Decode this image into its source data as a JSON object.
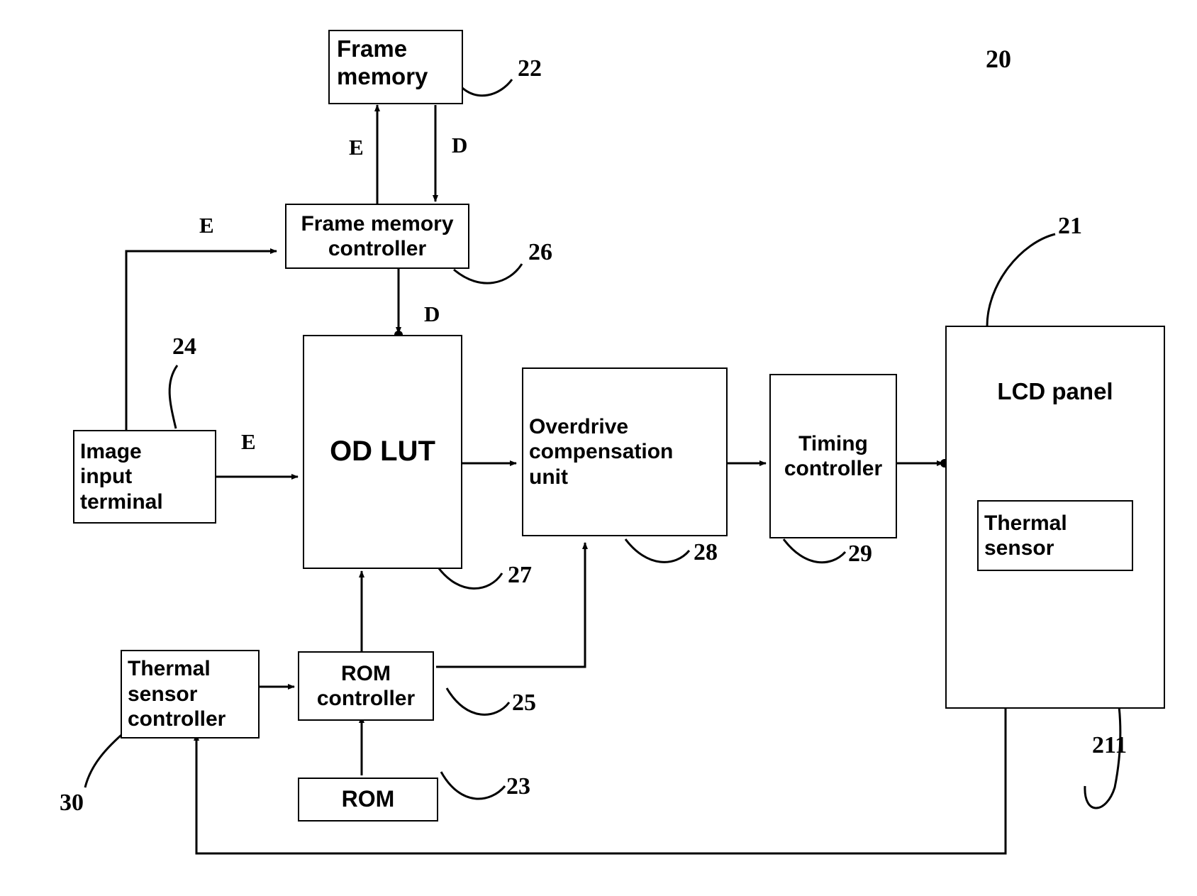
{
  "figure": {
    "title_ref": "20",
    "boxes": [
      {
        "id": "frame-memory",
        "label": "Frame\nmemory",
        "ref": "22"
      },
      {
        "id": "frame-memory-controller",
        "label": "Frame memory\ncontroller",
        "ref": "26"
      },
      {
        "id": "image-input-terminal",
        "label": "Image\ninput\nterminal",
        "ref": "24"
      },
      {
        "id": "od-lut",
        "label": "OD LUT",
        "ref": "27"
      },
      {
        "id": "overdrive-compensation-unit",
        "label": "Overdrive\ncompensation\nunit",
        "ref": "28"
      },
      {
        "id": "timing-controller",
        "label": "Timing\ncontroller",
        "ref": "29"
      },
      {
        "id": "lcd-panel",
        "label": "LCD panel",
        "ref": "21"
      },
      {
        "id": "thermal-sensor",
        "label": "Thermal\nsensor",
        "ref": "211"
      },
      {
        "id": "rom-controller",
        "label": "ROM\ncontroller",
        "ref": "25"
      },
      {
        "id": "rom",
        "label": "ROM",
        "ref": "23"
      },
      {
        "id": "thermal-sensor-controller",
        "label": "Thermal\nsensor\ncontroller",
        "ref": "30"
      }
    ],
    "signal_labels": [
      {
        "id": "e-frame-memory-up",
        "text": "E"
      },
      {
        "id": "d-frame-memory-down",
        "text": "D"
      },
      {
        "id": "e-input-to-fmc",
        "text": "E"
      },
      {
        "id": "d-fmc-to-odlut",
        "text": "D"
      },
      {
        "id": "e-input-to-odlut",
        "text": "E"
      }
    ],
    "reference_numerals": [
      "20",
      "21",
      "22",
      "23",
      "24",
      "25",
      "26",
      "27",
      "28",
      "29",
      "30",
      "211"
    ]
  }
}
